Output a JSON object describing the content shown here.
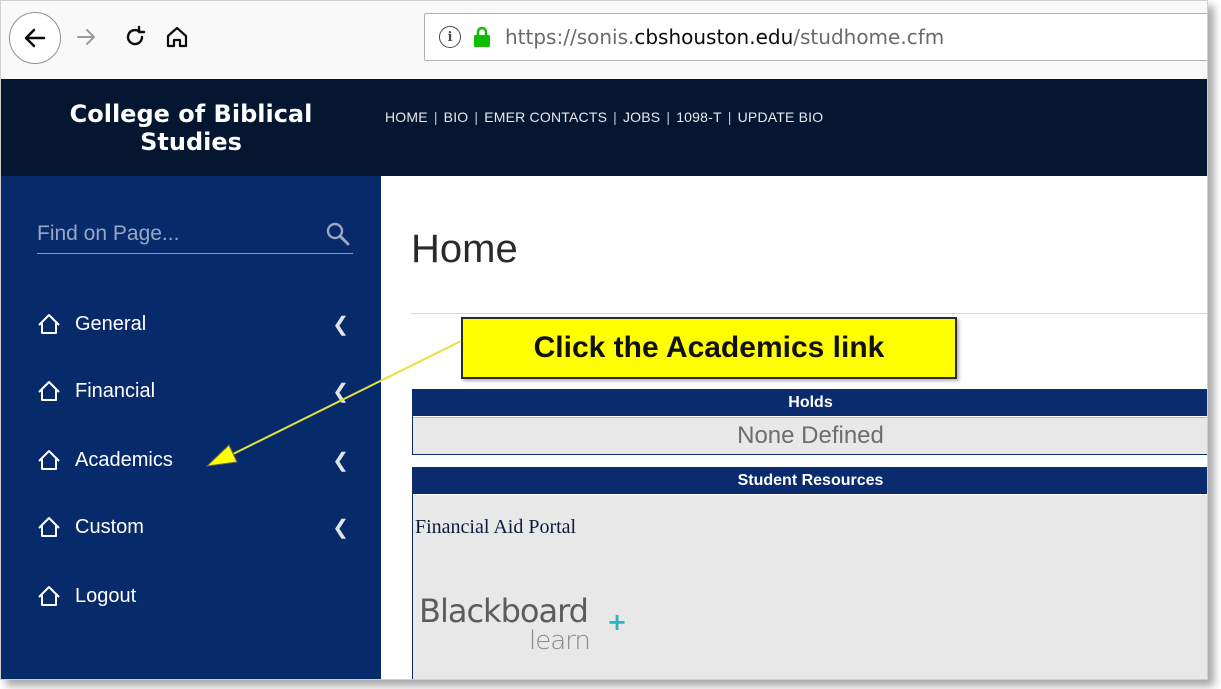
{
  "browser": {
    "url_prefix": "https://sonis.",
    "url_domain": "cbshouston.edu",
    "url_path": "/studhome.cfm"
  },
  "header": {
    "brand": "College of Biblical Studies",
    "nav": [
      "HOME",
      "BIO",
      "EMER CONTACTS",
      "JOBS",
      "1098-T",
      "UPDATE BIO"
    ]
  },
  "sidebar": {
    "search_placeholder": "Find on Page...",
    "items": [
      {
        "label": "General",
        "expandable": true
      },
      {
        "label": "Financial",
        "expandable": true
      },
      {
        "label": "Academics",
        "expandable": true
      },
      {
        "label": "Custom",
        "expandable": true
      },
      {
        "label": "Logout",
        "expandable": false
      }
    ]
  },
  "main": {
    "title": "Home",
    "holds": {
      "heading": "Holds",
      "value": "None Defined"
    },
    "resources": {
      "heading": "Student Resources",
      "link": "Financial Aid Portal",
      "logo_text_1": "Blackboard",
      "logo_text_2": "learn"
    }
  },
  "callout": {
    "text": "Click the Academics link"
  },
  "colors": {
    "nav_bg": "#041630",
    "sidebar_bg": "#072a6a",
    "panel_head": "#0b2b6f",
    "callout": "#ffff00",
    "lock": "#12bc00"
  }
}
